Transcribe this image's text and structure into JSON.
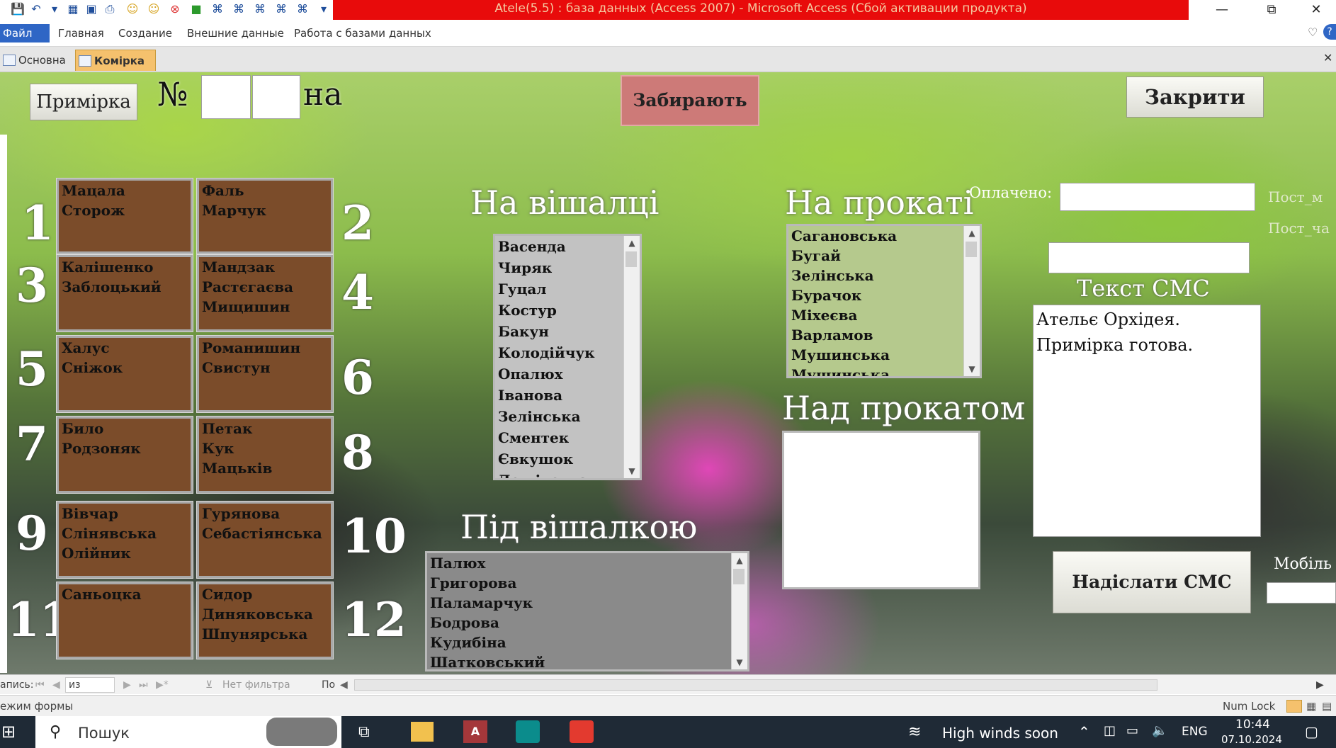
{
  "window": {
    "title": "Atele(5.5) : база данных (Access 2007) - Microsoft Access (Сбой активации продукта)",
    "minimize": "—",
    "restore": "⧉",
    "close": "✕"
  },
  "ribbon": {
    "file": "Файл",
    "tabs": [
      "Главная",
      "Создание",
      "Внешние данные",
      "Работа с базами данных"
    ]
  },
  "doc_tabs": [
    "Основна",
    "Комірка"
  ],
  "form": {
    "primirka_button": "Примірка",
    "number_label": "№",
    "na_label": "на",
    "zabyrayut_button": "Забирають",
    "close_button": "Закрити",
    "cells": [
      {
        "num": "1",
        "names": [
          "Мацала",
          "Сторож"
        ]
      },
      {
        "num": "2",
        "names": [
          "Фаль",
          "Марчук"
        ]
      },
      {
        "num": "3",
        "names": [
          "Калішенко",
          "Заблоцький"
        ]
      },
      {
        "num": "4",
        "names": [
          "Мандзак",
          "Растєгаєва",
          "Мищишин"
        ]
      },
      {
        "num": "5",
        "names": [
          "Халус",
          "Сніжок"
        ]
      },
      {
        "num": "6",
        "names": [
          "Романишин",
          "Свистун"
        ]
      },
      {
        "num": "7",
        "names": [
          "Било",
          "Родзоняк"
        ]
      },
      {
        "num": "8",
        "names": [
          "Петак",
          "Кук",
          "Мацьків"
        ]
      },
      {
        "num": "9",
        "names": [
          "Вівчар",
          "Слінявська",
          "Олійник"
        ]
      },
      {
        "num": "10",
        "names": [
          "Гурянова",
          "Себастіянська"
        ]
      },
      {
        "num": "11",
        "names": [
          "Саньоцка"
        ]
      },
      {
        "num": "12",
        "names": [
          "Сидор",
          "Диняковська",
          "Шпунярська"
        ]
      }
    ],
    "na_vishalci": {
      "heading": "На вішалці",
      "items": [
        "Васенда",
        "Чиряк",
        "Гуцал",
        "Костур",
        "Бакун",
        "Колодійчук",
        "Опалюх",
        "Іванова",
        "Зелінська",
        "Сментек",
        "Євкушок",
        "Дошівська"
      ]
    },
    "pid_vishalkoyu": {
      "heading": "Під вішалкою",
      "items": [
        "Палюх",
        "Григорова",
        "Паламарчук",
        "Бодрова",
        "Кудибіна",
        "Шатковський"
      ]
    },
    "na_prokati": {
      "heading": "На прокаті",
      "items": [
        "Сагановська",
        "Бугай",
        "Зелінська",
        "Бурачок",
        "Міхеєва",
        "Варламов",
        "Мушинська",
        "Мушинська"
      ]
    },
    "nad_prokatom": {
      "heading": "Над прокатом"
    },
    "oplacheno_label": "Оплачено:",
    "post_m_label": "Пост_м",
    "post_cha_label": "Пост_ча",
    "sms": {
      "heading": "Текст СМС",
      "lines": [
        "Ательє Орхідея.",
        "Примірка готова."
      ],
      "send_button": "Надіслати СМС",
      "mobile_label": "Мобіль"
    }
  },
  "record_nav": {
    "record_label": "апись:",
    "of_label": "из",
    "filter": "Нет фильтра",
    "search": "По"
  },
  "status": {
    "mode": "ежим формы",
    "numlock": "Num Lock"
  },
  "taskbar": {
    "search": "Пошук",
    "weather": "High winds soon",
    "lang": "ENG",
    "time": "10:44",
    "date": "07.10.2024"
  }
}
